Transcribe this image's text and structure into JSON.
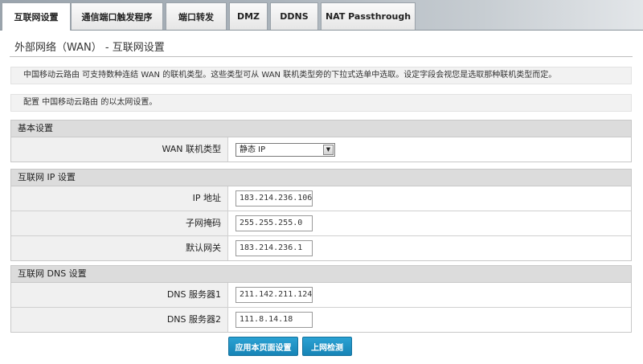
{
  "tabs": [
    {
      "label": "互联网设置",
      "active": true
    },
    {
      "label": "通信端口触发程序"
    },
    {
      "label": "端口转发"
    },
    {
      "label": "DMZ"
    },
    {
      "label": "DDNS"
    },
    {
      "label": "NAT Passthrough"
    }
  ],
  "page": {
    "title": "外部网络（WAN） - 互联网设置",
    "info1": "中国移动云路由 可支持数种连结 WAN 的联机类型。这些类型可从 WAN 联机类型旁的下拉式选单中选取。设定字段会视您是选取那种联机类型而定。",
    "info2": "配置 中国移动云路由 的以太网设置。"
  },
  "basic": {
    "header": "基本设置",
    "wan_type_label": "WAN 联机类型",
    "wan_type_value": "静态 IP"
  },
  "internet_ip": {
    "header": "互联网 IP 设置",
    "ip_label": "IP 地址",
    "ip_value": "183.214.236.106",
    "mask_label": "子网掩码",
    "mask_value": "255.255.255.0",
    "gateway_label": "默认网关",
    "gateway_value": "183.214.236.1"
  },
  "dns": {
    "header": "互联网 DNS 设置",
    "dns1_label": "DNS 服务器1",
    "dns1_value": "211.142.211.124",
    "dns2_label": "DNS 服务器2",
    "dns2_value": "111.8.14.18"
  },
  "buttons": {
    "apply": "应用本页面设置",
    "check": "上网检测"
  },
  "colors": {
    "button": "#1f92c6",
    "section_header": "#dcdcdc"
  }
}
